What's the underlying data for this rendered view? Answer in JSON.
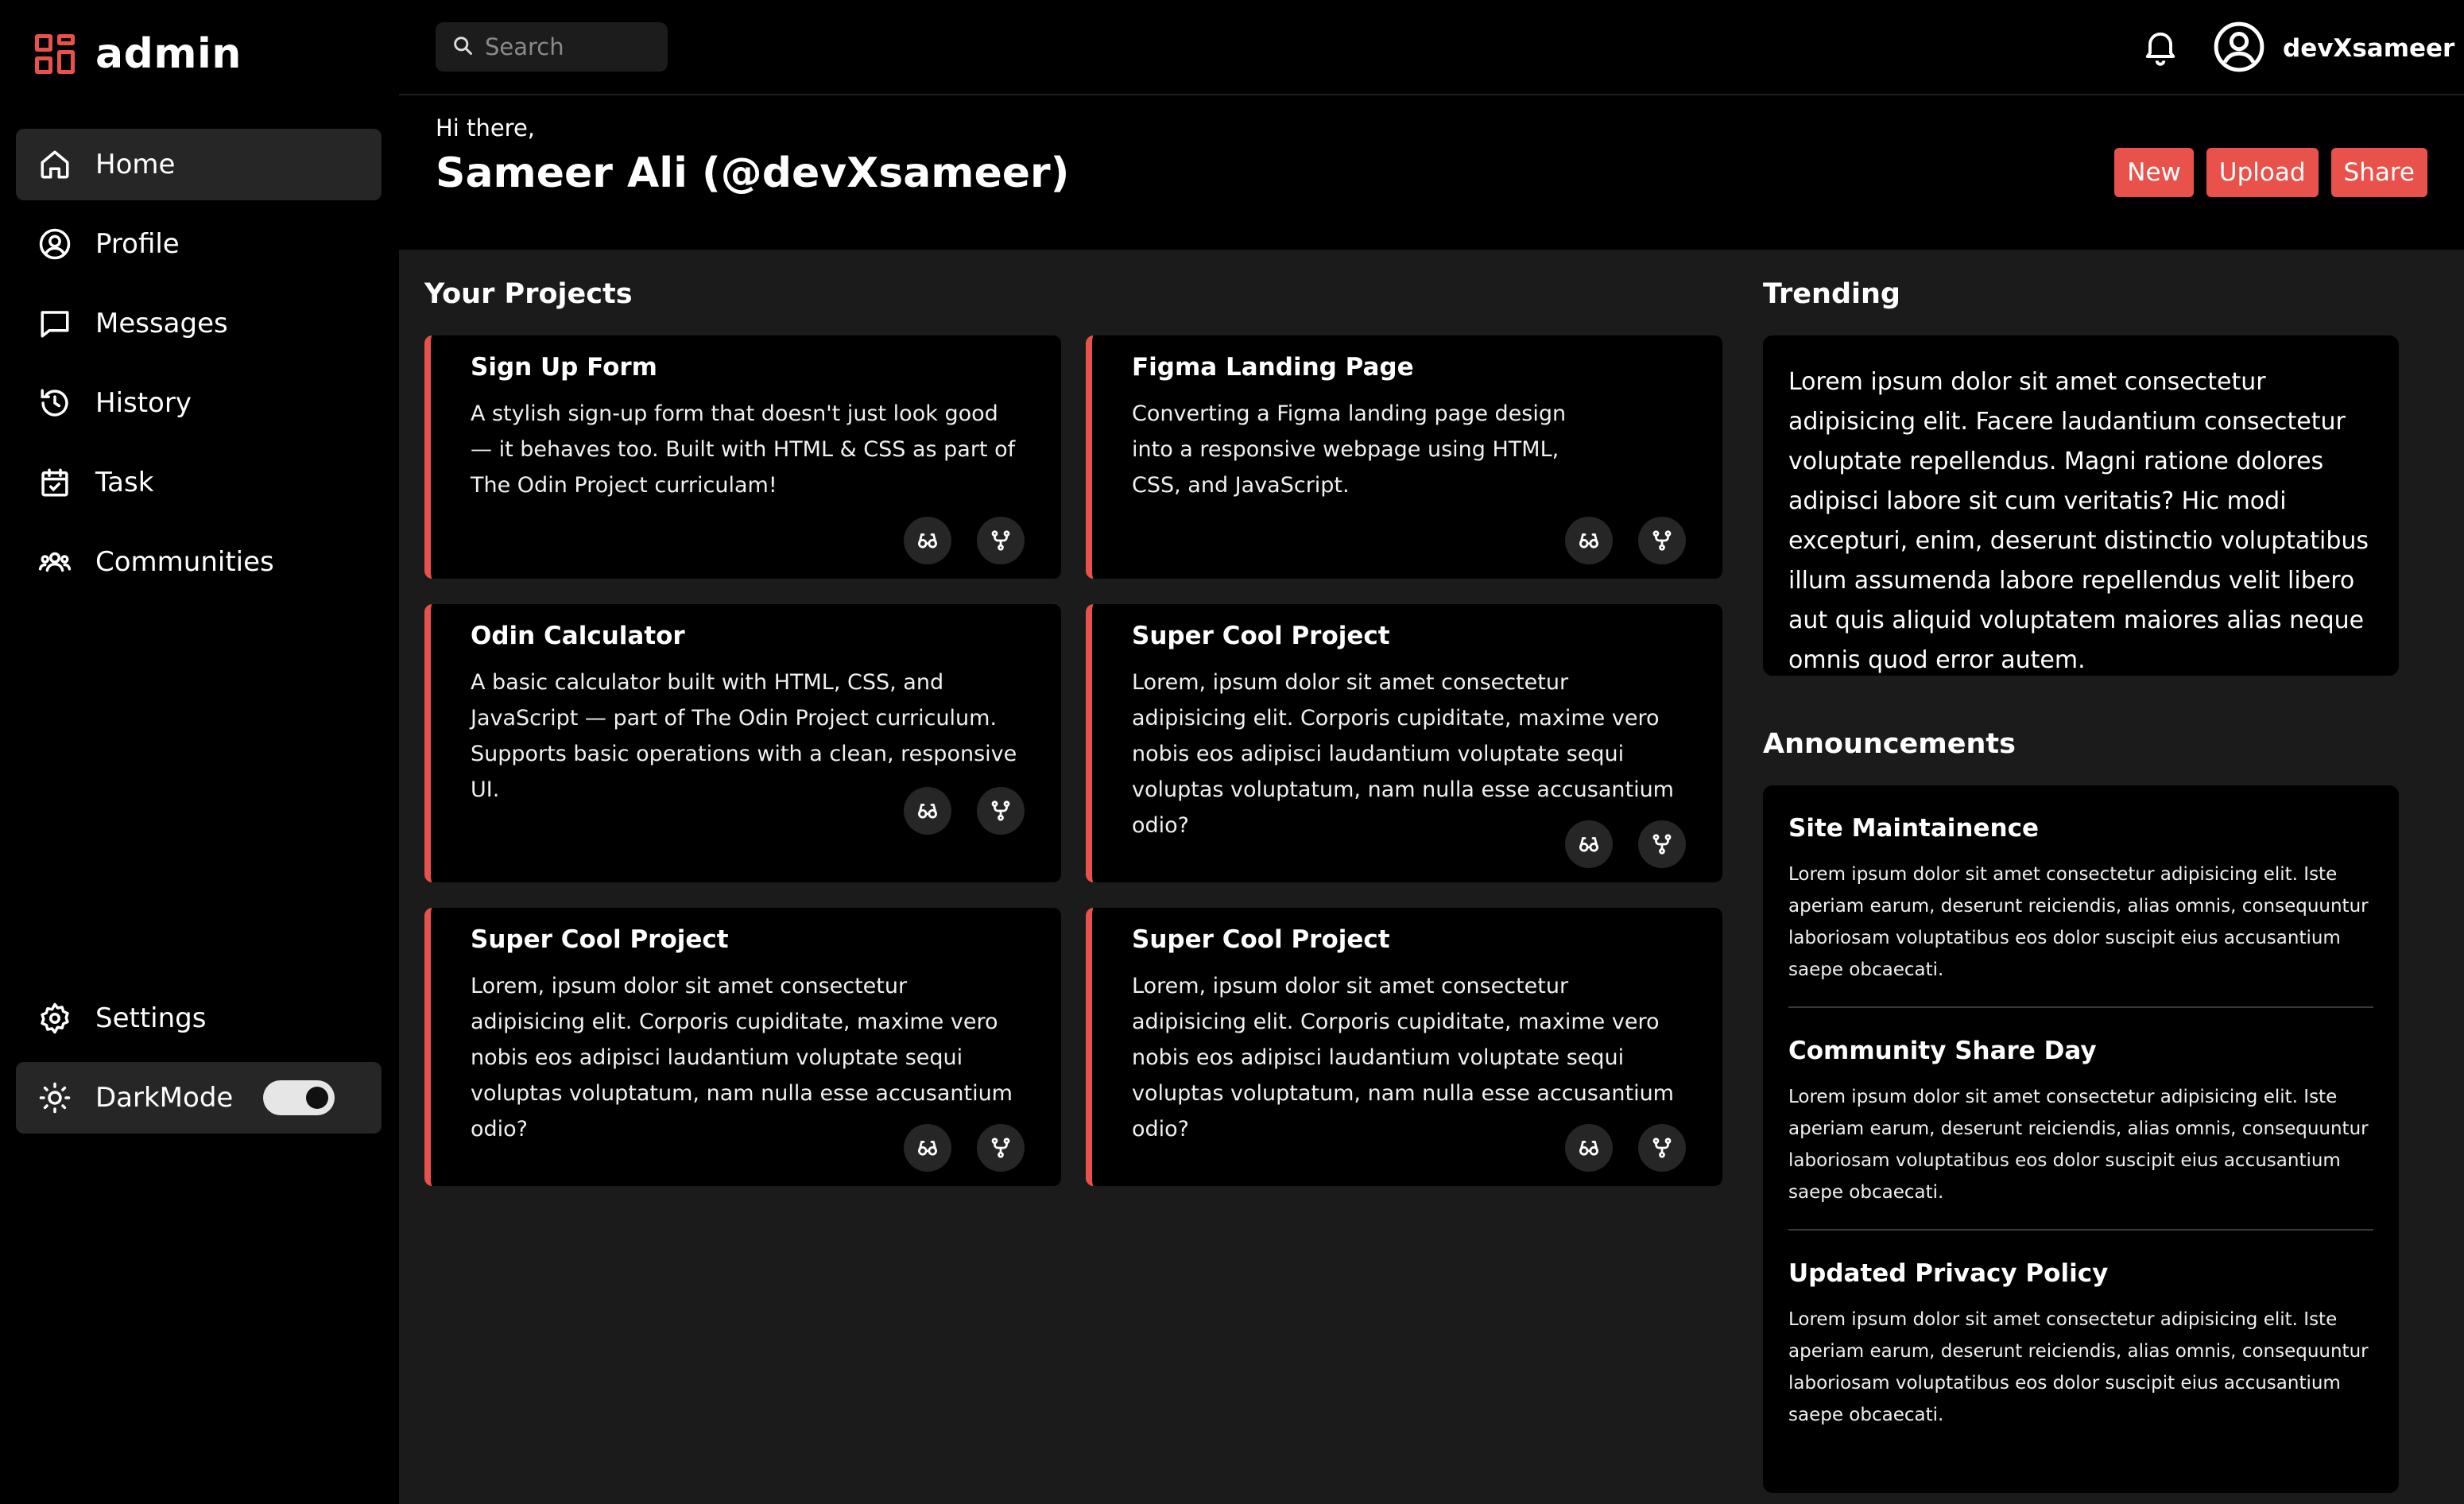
{
  "brand": {
    "name": "admin",
    "accent": "#e8524a"
  },
  "nav": {
    "items": [
      {
        "label": "Home",
        "icon": "home-icon",
        "active": true
      },
      {
        "label": "Profile",
        "icon": "user-circle-icon"
      },
      {
        "label": "Messages",
        "icon": "message-icon"
      },
      {
        "label": "History",
        "icon": "history-icon"
      },
      {
        "label": "Task",
        "icon": "calendar-check-icon"
      },
      {
        "label": "Communities",
        "icon": "users-icon"
      }
    ],
    "settings_label": "Settings",
    "darkmode_label": "DarkMode",
    "darkmode_on": true
  },
  "topbar": {
    "search_placeholder": "Search",
    "username": "devXsameer"
  },
  "header": {
    "greeting": "Hi there,",
    "name": "Sameer Ali (@devXsameer)",
    "actions": [
      "New",
      "Upload",
      "Share"
    ]
  },
  "projects": {
    "title": "Your Projects",
    "items": [
      {
        "title": "Sign Up Form",
        "desc": "A stylish sign-up form that doesn't just look good — it behaves too. Built with HTML & CSS as part of The Odin Project curriculam!"
      },
      {
        "title": "Figma Landing Page",
        "desc": "Converting a Figma landing page design into a responsive webpage using HTML, CSS, and JavaScript."
      },
      {
        "title": "Odin Calculator",
        "desc": "A basic calculator built with HTML, CSS, and JavaScript — part of The Odin Project curriculum. Supports basic operations with a clean, responsive UI."
      },
      {
        "title": "Super Cool Project",
        "desc": "Lorem, ipsum dolor sit amet consectetur adipisicing elit. Corporis cupiditate, maxime vero nobis eos adipisci laudantium voluptate sequi voluptas voluptatum, nam nulla esse accusantium odio?"
      },
      {
        "title": "Super Cool Project",
        "desc": "Lorem, ipsum dolor sit amet consectetur adipisicing elit. Corporis cupiditate, maxime vero nobis eos adipisci laudantium voluptate sequi voluptas voluptatum, nam nulla esse accusantium odio?"
      },
      {
        "title": "Super Cool Project",
        "desc": "Lorem, ipsum dolor sit amet consectetur adipisicing elit. Corporis cupiditate, maxime vero nobis eos adipisci laudantium voluptate sequi voluptas voluptatum, nam nulla esse accusantium odio?"
      }
    ]
  },
  "trending": {
    "title": "Trending",
    "text": "Lorem ipsum dolor sit amet consectetur adipisicing elit. Facere laudantium consectetur voluptate repellendus. Magni ratione dolores adipisci labore sit cum veritatis? Hic modi excepturi, enim, deserunt distinctio voluptatibus illum assumenda labore repellendus velit libero aut quis aliquid voluptatem maiores alias neque omnis quod error autem."
  },
  "announcements": {
    "title": "Announcements",
    "items": [
      {
        "title": "Site Maintainence",
        "body": "Lorem ipsum dolor sit amet consectetur adipisicing elit. Iste aperiam earum, deserunt reiciendis, alias omnis, consequuntur laboriosam voluptatibus eos dolor suscipit eius accusantium saepe obcaecati."
      },
      {
        "title": "Community Share Day",
        "body": "Lorem ipsum dolor sit amet consectetur adipisicing elit. Iste aperiam earum, deserunt reiciendis, alias omnis, consequuntur laboriosam voluptatibus eos dolor suscipit eius accusantium saepe obcaecati."
      },
      {
        "title": "Updated Privacy Policy",
        "body": "Lorem ipsum dolor sit amet consectetur adipisicing elit. Iste aperiam earum, deserunt reiciendis, alias omnis, consequuntur laboriosam voluptatibus eos dolor suscipit eius accusantium saepe obcaecati."
      }
    ]
  }
}
